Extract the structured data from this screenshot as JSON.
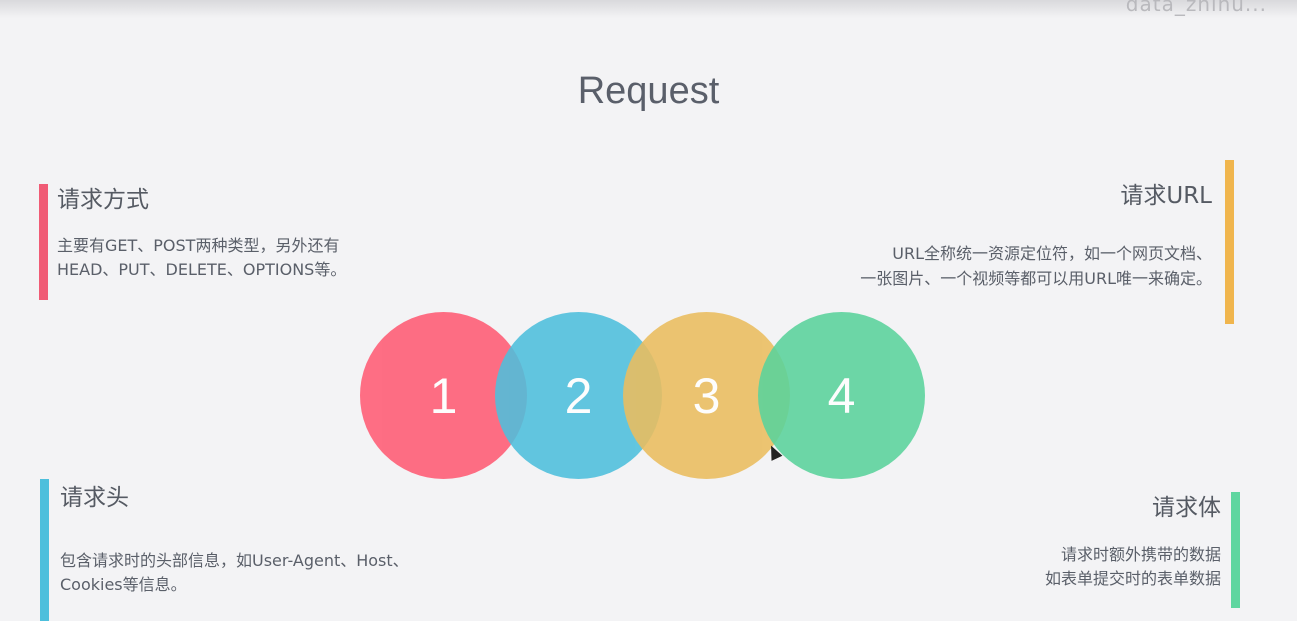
{
  "watermark": "data_zhihu...",
  "title": "Request",
  "sections": {
    "method": {
      "title": "请求方式",
      "lines": [
        "主要有GET、POST两种类型，另外还有",
        "HEAD、PUT、DELETE、OPTIONS等。"
      ],
      "color": "#f05b75"
    },
    "url": {
      "title": "请求URL",
      "lines": [
        "URL全称统一资源定位符，如一个网页文档、",
        "一张图片、一个视频等都可以用URL唯一来确定。"
      ],
      "color": "#f0b54d"
    },
    "headers": {
      "title": "请求头",
      "lines": [
        "包含请求时的头部信息，如User-Agent、Host、",
        "Cookies等信息。"
      ],
      "color": "#4dbfdc"
    },
    "body": {
      "title": "请求体",
      "lines": [
        "请求时额外携带的数据",
        "如表单提交时的表单数据"
      ],
      "color": "#5fd6a0"
    }
  },
  "circles": [
    {
      "label": "1",
      "color": "#ff5b74"
    },
    {
      "label": "2",
      "color": "#4ebfdc"
    },
    {
      "label": "3",
      "color": "#ebbd5e"
    },
    {
      "label": "4",
      "color": "#5ad39c"
    }
  ]
}
